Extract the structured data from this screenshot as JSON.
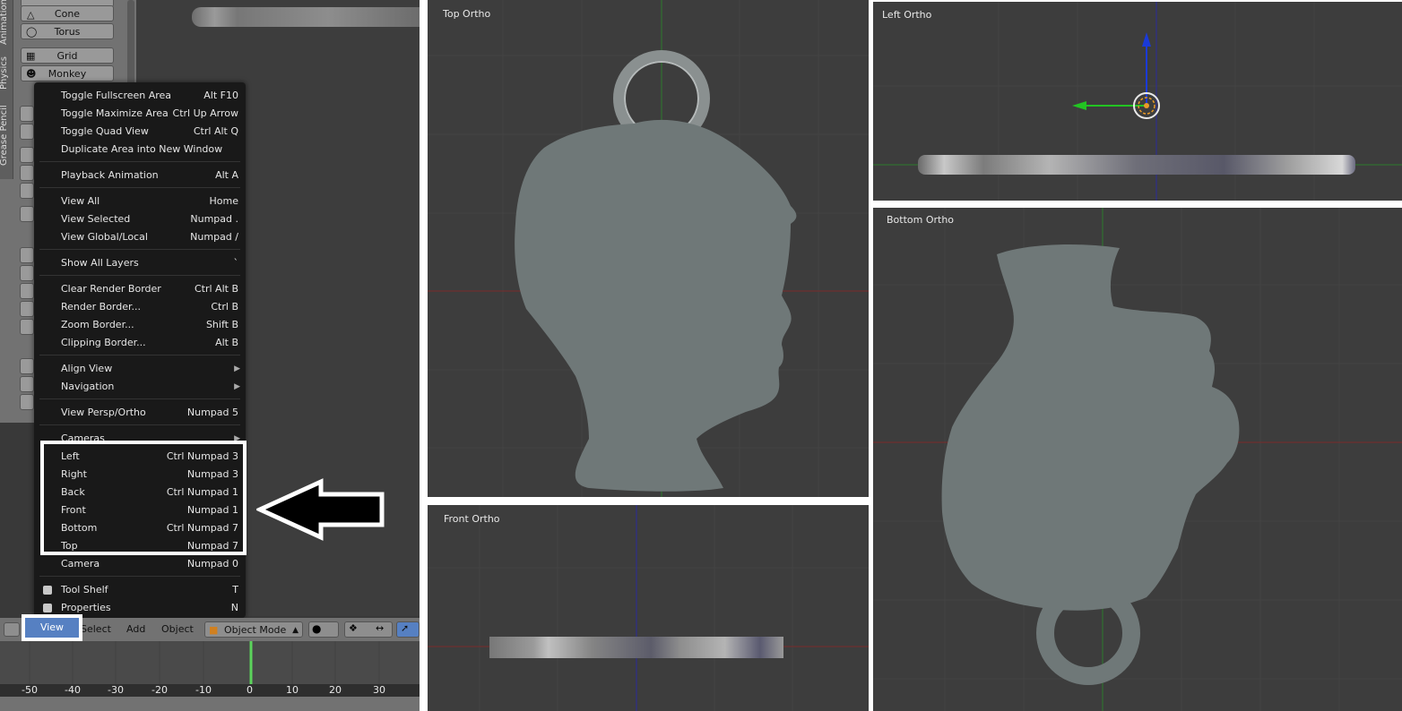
{
  "tool_shelf": {
    "tabs": [
      "Animation",
      "Physics",
      "Grease Pencil"
    ],
    "buttons": [
      "Cone",
      "Torus",
      "Grid",
      "Monkey"
    ]
  },
  "menu": {
    "items": [
      {
        "label": "Toggle Fullscreen Area",
        "shortcut": "Alt F10"
      },
      {
        "label": "Toggle Maximize Area",
        "shortcut": "Ctrl Up Arrow"
      },
      {
        "label": "Toggle Quad View",
        "shortcut": "Ctrl Alt Q"
      },
      {
        "label": "Duplicate Area into New Window",
        "shortcut": ""
      },
      {
        "label": "Playback Animation",
        "shortcut": "Alt A"
      },
      {
        "label": "View All",
        "shortcut": "Home"
      },
      {
        "label": "View Selected",
        "shortcut": "Numpad ."
      },
      {
        "label": "View Global/Local",
        "shortcut": "Numpad /"
      },
      {
        "label": "Show All Layers",
        "shortcut": "`"
      },
      {
        "label": "Clear Render Border",
        "shortcut": "Ctrl Alt B"
      },
      {
        "label": "Render Border...",
        "shortcut": "Ctrl B"
      },
      {
        "label": "Zoom Border...",
        "shortcut": "Shift B"
      },
      {
        "label": "Clipping Border...",
        "shortcut": "Alt B"
      },
      {
        "label": "Align View",
        "shortcut": ""
      },
      {
        "label": "Navigation",
        "shortcut": ""
      },
      {
        "label": "View Persp/Ortho",
        "shortcut": "Numpad 5"
      },
      {
        "label": "Cameras",
        "shortcut": ""
      },
      {
        "label": "Left",
        "shortcut": "Ctrl Numpad 3"
      },
      {
        "label": "Right",
        "shortcut": "Numpad 3"
      },
      {
        "label": "Back",
        "shortcut": "Ctrl Numpad 1"
      },
      {
        "label": "Front",
        "shortcut": "Numpad 1"
      },
      {
        "label": "Bottom",
        "shortcut": "Ctrl Numpad 7"
      },
      {
        "label": "Top",
        "shortcut": "Numpad 7"
      },
      {
        "label": "Camera",
        "shortcut": "Numpad 0"
      },
      {
        "label": "Tool Shelf",
        "shortcut": "T"
      },
      {
        "label": "Properties",
        "shortcut": "N"
      }
    ]
  },
  "header": {
    "view": "View",
    "select": "Select",
    "add": "Add",
    "object": "Object",
    "mode": "Object Mode"
  },
  "timeline": {
    "ticks": [
      "-50",
      "-40",
      "-30",
      "-20",
      "-10",
      "0",
      "10",
      "20",
      "30"
    ]
  },
  "viewports": {
    "top": "Top Ortho",
    "front": "Front Ortho",
    "left": "Left Ortho",
    "bottom": "Bottom Ortho"
  },
  "colors": {
    "viewport_bg": "#3d3d3d",
    "mesh": "#6f7878",
    "menu_bg": "#191919",
    "highlight": "#5680c2",
    "x_axis": "#8a2a2a",
    "y_axis": "#2a8a2a",
    "z_axis": "#2a2a9a"
  }
}
